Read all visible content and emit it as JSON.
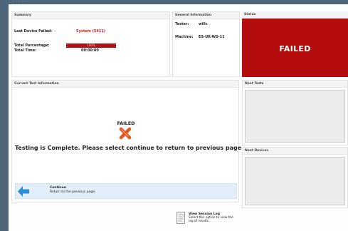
{
  "top_strip": {
    "text": "· · · · · · · · ·"
  },
  "summary": {
    "header": "Summary",
    "last_device_failed_label": "Last Device Failed:",
    "last_device_failed_value": "System (5411)",
    "total_percentage_label": "Total Percentage:",
    "total_percentage_value": "100%",
    "total_time_label": "Total Time:",
    "total_time_value": "00:00:00"
  },
  "general": {
    "header": "General Information",
    "tester_label": "Tester:",
    "tester_value": "willc",
    "machine_label": "Machine:",
    "machine_value": "ES-UK-WS-11"
  },
  "status": {
    "header": "Status",
    "text": "FAILED",
    "color": "#b50d0d"
  },
  "current": {
    "header": "Current Test Information",
    "failed_label": "FAILED",
    "icon": "x-icon",
    "message": "Testing is Complete. Please select continue to return to previous page.",
    "continue_title": "Continue",
    "continue_desc": "Return to the previous page."
  },
  "next_tests": {
    "header": "Next Tests"
  },
  "next_devices": {
    "header": "Next Devices"
  },
  "session_log": {
    "title": "View Session Log",
    "desc": "Select this option to view the log of results."
  }
}
